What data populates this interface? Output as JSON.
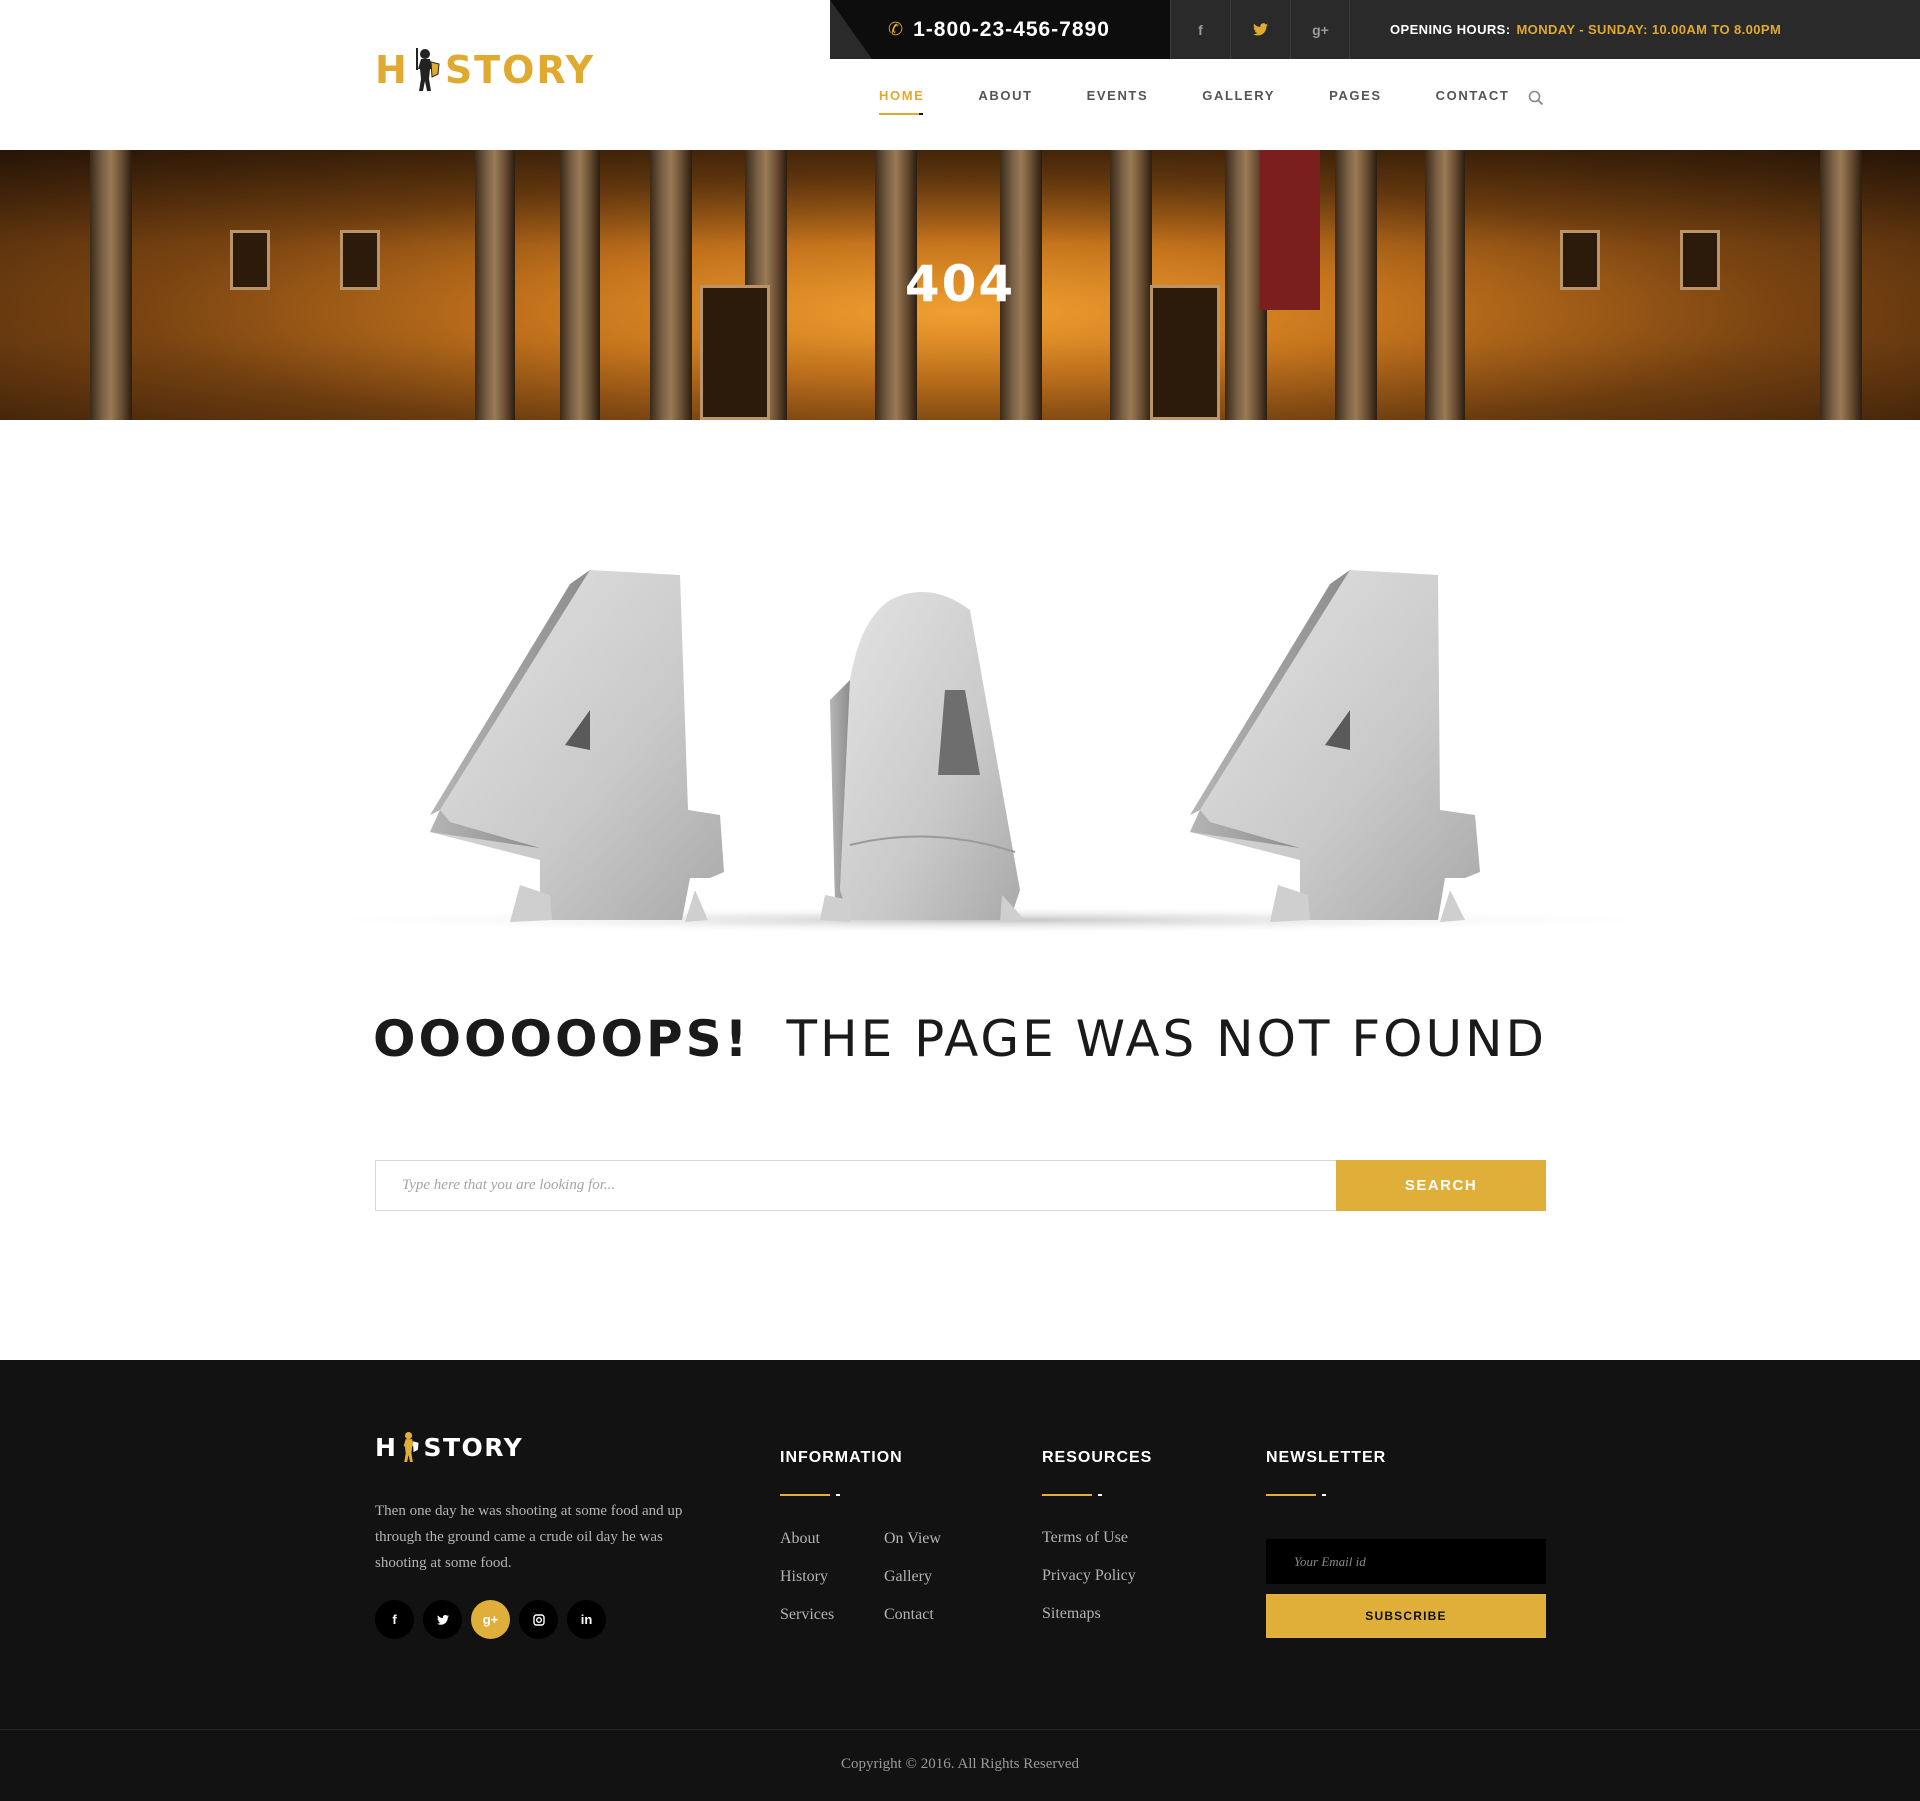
{
  "brand": {
    "logo_left": "H",
    "logo_right": "STORY"
  },
  "topbar": {
    "phone": "1-800-23-456-7890",
    "social": [
      {
        "icon": "facebook-icon",
        "glyph": "f"
      },
      {
        "icon": "twitter-icon",
        "glyph": "t"
      },
      {
        "icon": "google-plus-icon",
        "glyph": "g+"
      }
    ],
    "hours_label": "OPENING HOURS:",
    "hours_value": "MONDAY - SUNDAY: 10.00AM TO 8.00PM"
  },
  "nav": {
    "items": [
      "HOME",
      "ABOUT",
      "EVENTS",
      "GALLERY",
      "PAGES",
      "CONTACT"
    ],
    "active": "HOME"
  },
  "banner": {
    "title": "404"
  },
  "error": {
    "oops_strong": "OOOOOOPS!",
    "oops_text": "THE PAGE WAS NOT FOUND"
  },
  "search": {
    "placeholder": "Type here that you are looking for...",
    "button": "SEARCH"
  },
  "footer": {
    "logo_left": "H",
    "logo_right": "STORY",
    "about": "Then one day he was shooting at some food and up through the ground came a crude oil day he was shooting at some food.",
    "social": [
      "facebook-icon",
      "twitter-icon",
      "google-plus-icon",
      "instagram-icon",
      "linkedin-icon"
    ],
    "active_social": "google-plus-icon",
    "information": {
      "title": "INFORMATION",
      "col1": [
        "About",
        "History",
        "Services"
      ],
      "col2": [
        "On View",
        "Gallery",
        "Contact"
      ]
    },
    "resources": {
      "title": "RESOURCES",
      "links": [
        "Terms of Use",
        "Privacy Policy",
        "Sitemaps"
      ]
    },
    "newsletter": {
      "title": "NEWSLETTER",
      "placeholder": "Your Email id",
      "button": "SUBSCRIBE"
    },
    "copyright": "Copyright © 2016. All Rights Reserved"
  },
  "colors": {
    "accent": "#e0af3a",
    "dark": "#121212",
    "topbar": "#2a2a2a"
  }
}
